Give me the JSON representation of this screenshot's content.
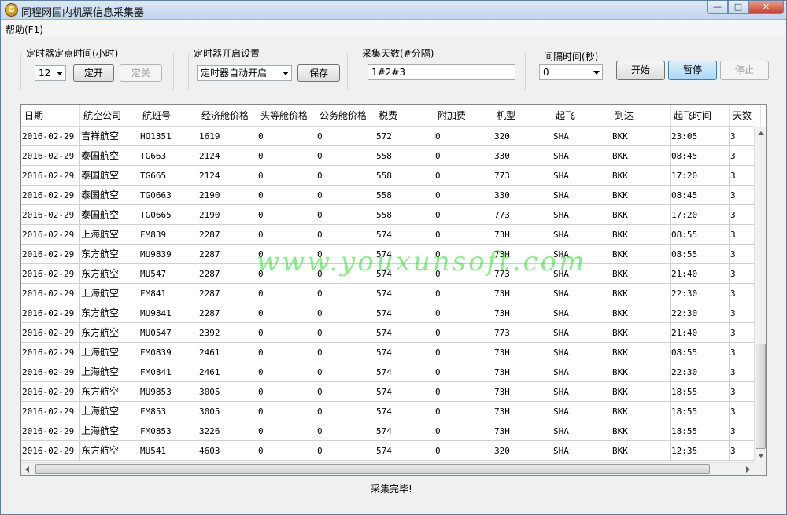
{
  "window": {
    "title": "同程网国内机票信息采集器",
    "icon": "app-logo-icon",
    "controls": {
      "minimize": "—",
      "maximize": "□",
      "close": "✕"
    }
  },
  "menu": {
    "help": "帮助(F1)"
  },
  "timer_group": {
    "label": "定时器定点时间(小时)",
    "hour_value": "12",
    "on_button": "定开",
    "off_button": "定关"
  },
  "timer_start_group": {
    "label": "定时器开启设置",
    "mode_value": "定时器自动开启",
    "save_button": "保存"
  },
  "days_group": {
    "label": "采集天数(#分隔)",
    "value": "1#2#3"
  },
  "interval": {
    "label": "间隔时间(秒)",
    "value": "0"
  },
  "actions": {
    "start": "开始",
    "pause": "暂停",
    "stop": "停止"
  },
  "table": {
    "columns": [
      "日期",
      "航空公司",
      "航班号",
      "经济舱价格",
      "头等舱价格",
      "公务舱价格",
      "税费",
      "附加费",
      "机型",
      "起飞",
      "到达",
      "起飞时间",
      "天数"
    ],
    "rows": [
      [
        "2016-02-29",
        "吉祥航空",
        "HO1351",
        "1619",
        "0",
        "0",
        "572",
        "0",
        "320",
        "SHA",
        "BKK",
        "23:05",
        "3"
      ],
      [
        "2016-02-29",
        "泰国航空",
        "TG663",
        "2124",
        "0",
        "0",
        "558",
        "0",
        "330",
        "SHA",
        "BKK",
        "08:45",
        "3"
      ],
      [
        "2016-02-29",
        "泰国航空",
        "TG665",
        "2124",
        "0",
        "0",
        "558",
        "0",
        "773",
        "SHA",
        "BKK",
        "17:20",
        "3"
      ],
      [
        "2016-02-29",
        "泰国航空",
        "TG0663",
        "2190",
        "0",
        "0",
        "558",
        "0",
        "330",
        "SHA",
        "BKK",
        "08:45",
        "3"
      ],
      [
        "2016-02-29",
        "泰国航空",
        "TG0665",
        "2190",
        "0",
        "0",
        "558",
        "0",
        "773",
        "SHA",
        "BKK",
        "17:20",
        "3"
      ],
      [
        "2016-02-29",
        "上海航空",
        "FM839",
        "2287",
        "0",
        "0",
        "574",
        "0",
        "73H",
        "SHA",
        "BKK",
        "08:55",
        "3"
      ],
      [
        "2016-02-29",
        "东方航空",
        "MU9839",
        "2287",
        "0",
        "0",
        "574",
        "0",
        "73H",
        "SHA",
        "BKK",
        "08:55",
        "3"
      ],
      [
        "2016-02-29",
        "东方航空",
        "MU547",
        "2287",
        "0",
        "0",
        "574",
        "0",
        "773",
        "SHA",
        "BKK",
        "21:40",
        "3"
      ],
      [
        "2016-02-29",
        "上海航空",
        "FM841",
        "2287",
        "0",
        "0",
        "574",
        "0",
        "73H",
        "SHA",
        "BKK",
        "22:30",
        "3"
      ],
      [
        "2016-02-29",
        "东方航空",
        "MU9841",
        "2287",
        "0",
        "0",
        "574",
        "0",
        "73H",
        "SHA",
        "BKK",
        "22:30",
        "3"
      ],
      [
        "2016-02-29",
        "东方航空",
        "MU0547",
        "2392",
        "0",
        "0",
        "574",
        "0",
        "773",
        "SHA",
        "BKK",
        "21:40",
        "3"
      ],
      [
        "2016-02-29",
        "上海航空",
        "FM0839",
        "2461",
        "0",
        "0",
        "574",
        "0",
        "73H",
        "SHA",
        "BKK",
        "08:55",
        "3"
      ],
      [
        "2016-02-29",
        "上海航空",
        "FM0841",
        "2461",
        "0",
        "0",
        "574",
        "0",
        "73H",
        "SHA",
        "BKK",
        "22:30",
        "3"
      ],
      [
        "2016-02-29",
        "东方航空",
        "MU9853",
        "3005",
        "0",
        "0",
        "574",
        "0",
        "73H",
        "SHA",
        "BKK",
        "18:55",
        "3"
      ],
      [
        "2016-02-29",
        "上海航空",
        "FM853",
        "3005",
        "0",
        "0",
        "574",
        "0",
        "73H",
        "SHA",
        "BKK",
        "18:55",
        "3"
      ],
      [
        "2016-02-29",
        "上海航空",
        "FM0853",
        "3226",
        "0",
        "0",
        "574",
        "0",
        "73H",
        "SHA",
        "BKK",
        "18:55",
        "3"
      ],
      [
        "2016-02-29",
        "东方航空",
        "MU541",
        "4603",
        "0",
        "0",
        "574",
        "0",
        "320",
        "SHA",
        "BKK",
        "12:35",
        "3"
      ]
    ]
  },
  "watermark": "www.youxunsoft.com",
  "status": "采集完毕!"
}
